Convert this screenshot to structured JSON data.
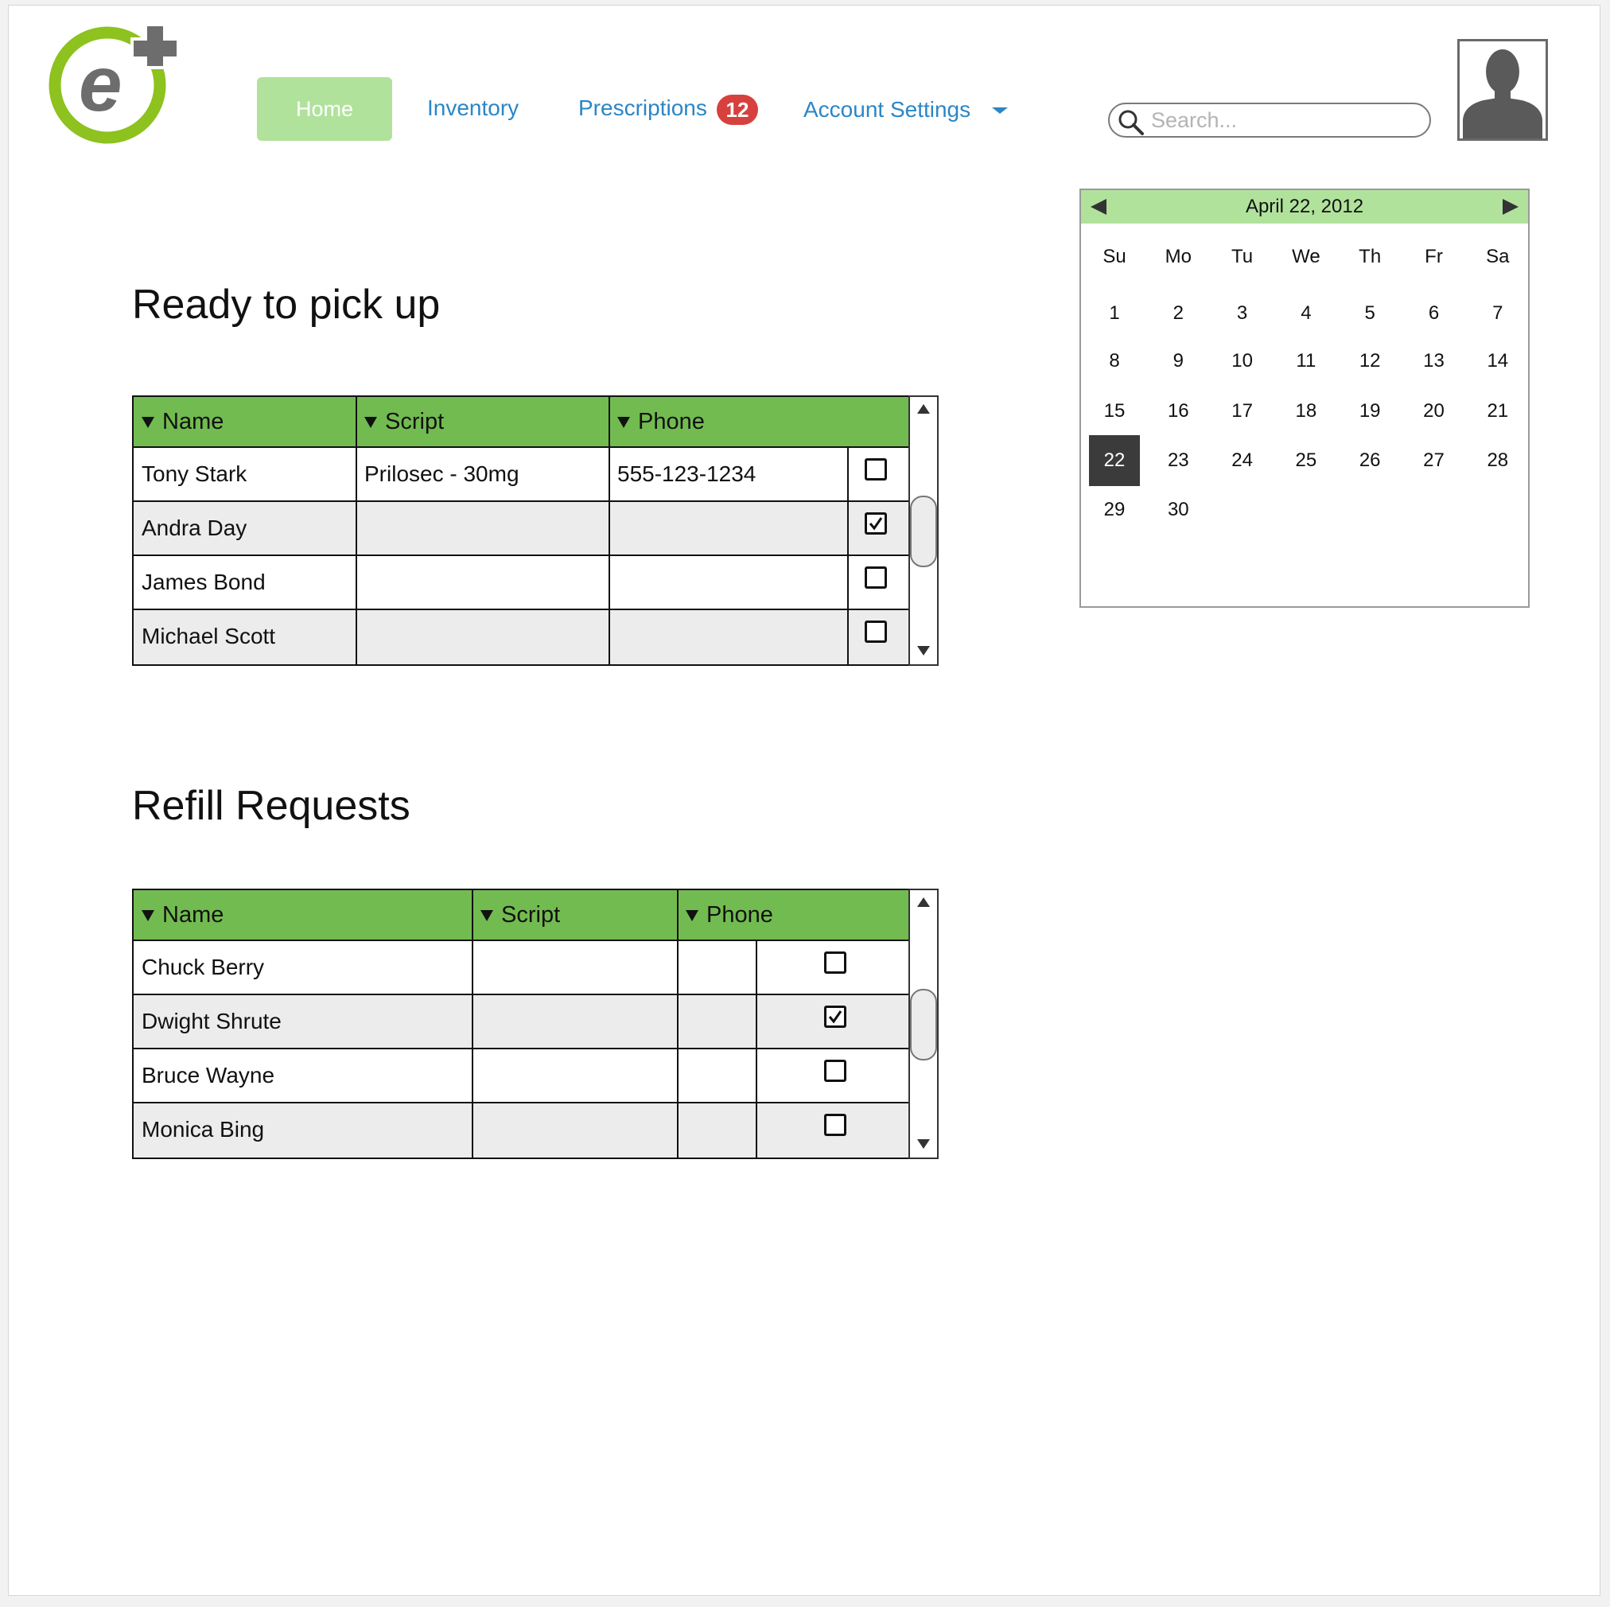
{
  "nav": {
    "home_label": "Home",
    "inventory_label": "Inventory",
    "prescriptions_label": "Prescriptions",
    "prescriptions_badge": "12",
    "account_label": "Account Settings"
  },
  "search": {
    "placeholder": "Search..."
  },
  "ready": {
    "title": "Ready to pick up",
    "columns": [
      "Name",
      "Script",
      "Phone"
    ],
    "rows": [
      {
        "name": "Tony Stark",
        "script": "Prilosec - 30mg",
        "phone": "555-123-1234",
        "checked": false
      },
      {
        "name": "Andra Day",
        "script": "",
        "phone": "",
        "checked": true
      },
      {
        "name": "James Bond",
        "script": "",
        "phone": "",
        "checked": false
      },
      {
        "name": "Michael Scott",
        "script": "",
        "phone": "",
        "checked": false
      }
    ]
  },
  "refill": {
    "title": "Refill Requests",
    "columns": [
      "Name",
      "Script",
      "Phone"
    ],
    "rows": [
      {
        "name": "Chuck Berry",
        "script": "",
        "phone": "",
        "checked": false
      },
      {
        "name": "Dwight Shrute",
        "script": "",
        "phone": "",
        "checked": true
      },
      {
        "name": "Bruce Wayne",
        "script": "",
        "phone": "",
        "checked": false
      },
      {
        "name": "Monica Bing",
        "script": "",
        "phone": "",
        "checked": false
      }
    ]
  },
  "calendar": {
    "title": "April 22, 2012",
    "weekdays": [
      "Su",
      "Mo",
      "Tu",
      "We",
      "Th",
      "Fr",
      "Sa"
    ],
    "days": [
      "1",
      "2",
      "3",
      "4",
      "5",
      "6",
      "7",
      "8",
      "9",
      "10",
      "11",
      "12",
      "13",
      "14",
      "15",
      "16",
      "17",
      "18",
      "19",
      "20",
      "21",
      "22",
      "23",
      "24",
      "25",
      "26",
      "27",
      "28",
      "29",
      "30"
    ],
    "selected": "22",
    "header_color": "#b0e29c"
  },
  "colors": {
    "table_header": "#72bb50",
    "nav_active": "#b0e29c",
    "link": "#2b86c6",
    "badge": "#d6413d",
    "logo_green": "#8dc21f",
    "logo_gray": "#6d6d6d"
  },
  "icons": [
    "logo-e-plus",
    "search-icon",
    "avatar-silhouette",
    "sort-arrow-icon",
    "checkbox",
    "scroll-up-arrow",
    "scroll-down-arrow",
    "calendar-prev-arrow",
    "calendar-next-arrow",
    "dropdown-caret-icon"
  ]
}
